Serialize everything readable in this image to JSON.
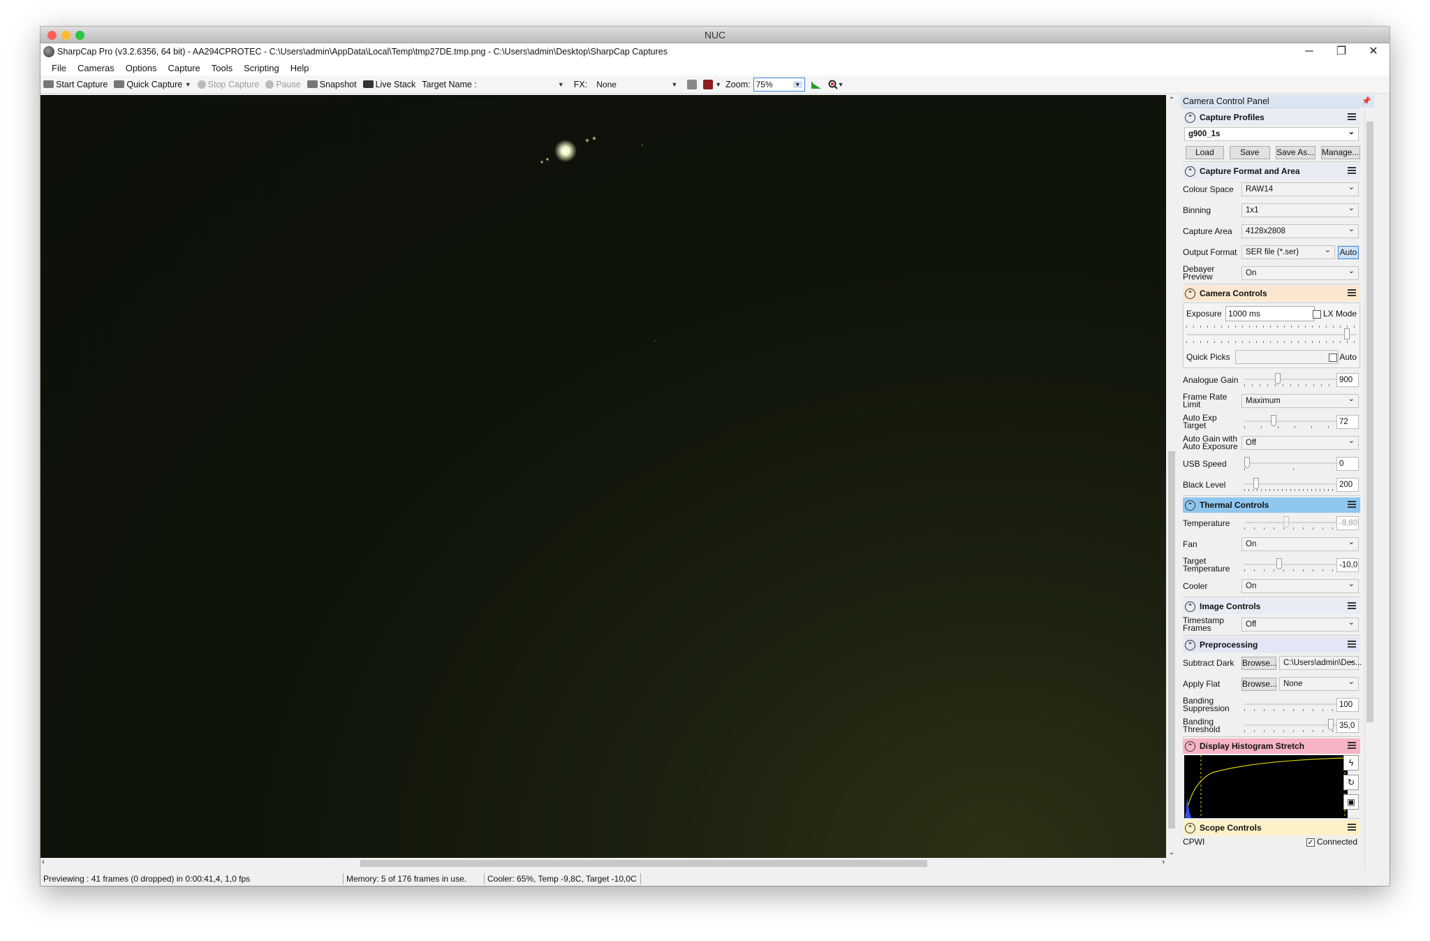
{
  "mac_title": "NUC",
  "window_title": "SharpCap Pro (v3.2.6356, 64 bit) - AA294CPROTEC - C:\\Users\\admin\\AppData\\Local\\Temp\\tmp27DE.tmp.png - C:\\Users\\admin\\Desktop\\SharpCap Captures",
  "menu": [
    "File",
    "Cameras",
    "Options",
    "Capture",
    "Tools",
    "Scripting",
    "Help"
  ],
  "toolbar": {
    "start_capture": "Start Capture",
    "quick_capture": "Quick Capture",
    "stop_capture": "Stop Capture",
    "pause": "Pause",
    "snapshot": "Snapshot",
    "live_stack": "Live Stack",
    "target_name_label": "Target Name :",
    "target_name_value": "",
    "fx_label": "FX:",
    "fx_value": "None",
    "zoom_label": "Zoom:",
    "zoom_value": "75%"
  },
  "status": {
    "previewing": "Previewing : 41 frames (0 dropped) in 0:00:41,4, 1,0 fps",
    "memory": "Memory: 5 of 176 frames in use.",
    "cooler": "Cooler: 65%, Temp -9,8C, Target -10,0C"
  },
  "panel": {
    "title": "Camera Control Panel",
    "capture_profiles": {
      "header": "Capture Profiles",
      "profile": "g900_1s",
      "buttons": [
        "Load",
        "Save",
        "Save As...",
        "Manage..."
      ]
    },
    "capture_format": {
      "header": "Capture Format and Area",
      "colour_space_label": "Colour Space",
      "colour_space": "RAW14",
      "binning_label": "Binning",
      "binning": "1x1",
      "capture_area_label": "Capture Area",
      "capture_area": "4128x2808",
      "output_format_label": "Output Format",
      "output_format": "SER file (*.ser)",
      "auto_btn": "Auto",
      "debayer_label": "Debayer Preview",
      "debayer": "On"
    },
    "camera_controls": {
      "header": "Camera Controls",
      "exposure_label": "Exposure",
      "exposure": "1000 ms",
      "lx_mode": "LX Mode",
      "quick_picks_label": "Quick Picks",
      "auto_label": "Auto",
      "gain_label": "Analogue Gain",
      "gain": "900",
      "gain_level": 0.33,
      "frame_rate_label": "Frame Rate Limit",
      "frame_rate": "Maximum",
      "auto_exp_label": "Auto Exp Target",
      "auto_exp": "72",
      "auto_exp_level": 0.28,
      "auto_gain_label": "Auto Gain with Auto Exposure",
      "auto_gain": "Off",
      "usb_label": "USB Speed",
      "usb": "0",
      "usb_level": 0.0,
      "black_label": "Black Level",
      "black": "200",
      "black_level": 0.1
    },
    "thermal": {
      "header": "Thermal Controls",
      "temp_label": "Temperature",
      "temp": "-9,80",
      "fan_label": "Fan",
      "fan": "On",
      "target_label": "Target Temperature",
      "target": "-10,0",
      "cooler_label": "Cooler",
      "cooler": "On"
    },
    "image_controls": {
      "header": "Image Controls",
      "timestamp_label": "Timestamp Frames",
      "timestamp": "Off"
    },
    "preprocessing": {
      "header": "Preprocessing",
      "dark_label": "Subtract Dark",
      "browse": "Browse...",
      "dark": "C:\\Users\\admin\\Des...",
      "flat_label": "Apply Flat",
      "flat": "None",
      "banding_sup_label": "Banding Suppression",
      "banding_sup": "100",
      "banding_thr_label": "Banding Threshold",
      "banding_thr": "35,0"
    },
    "histogram": {
      "header": "Display Histogram Stretch"
    },
    "scope": {
      "header": "Scope Controls",
      "cpwi": "CPWI",
      "connected": "Connected"
    }
  },
  "colors": {
    "camera_controls_bg": "#fbe7cf",
    "thermal_bg": "#8fc7ef",
    "preprocessing_bg": "#e2e6f5",
    "histogram_bg": "#f7b4c4",
    "scope_bg": "#fdf1c8",
    "capture_profiles_bg": "#e8ecf4"
  }
}
